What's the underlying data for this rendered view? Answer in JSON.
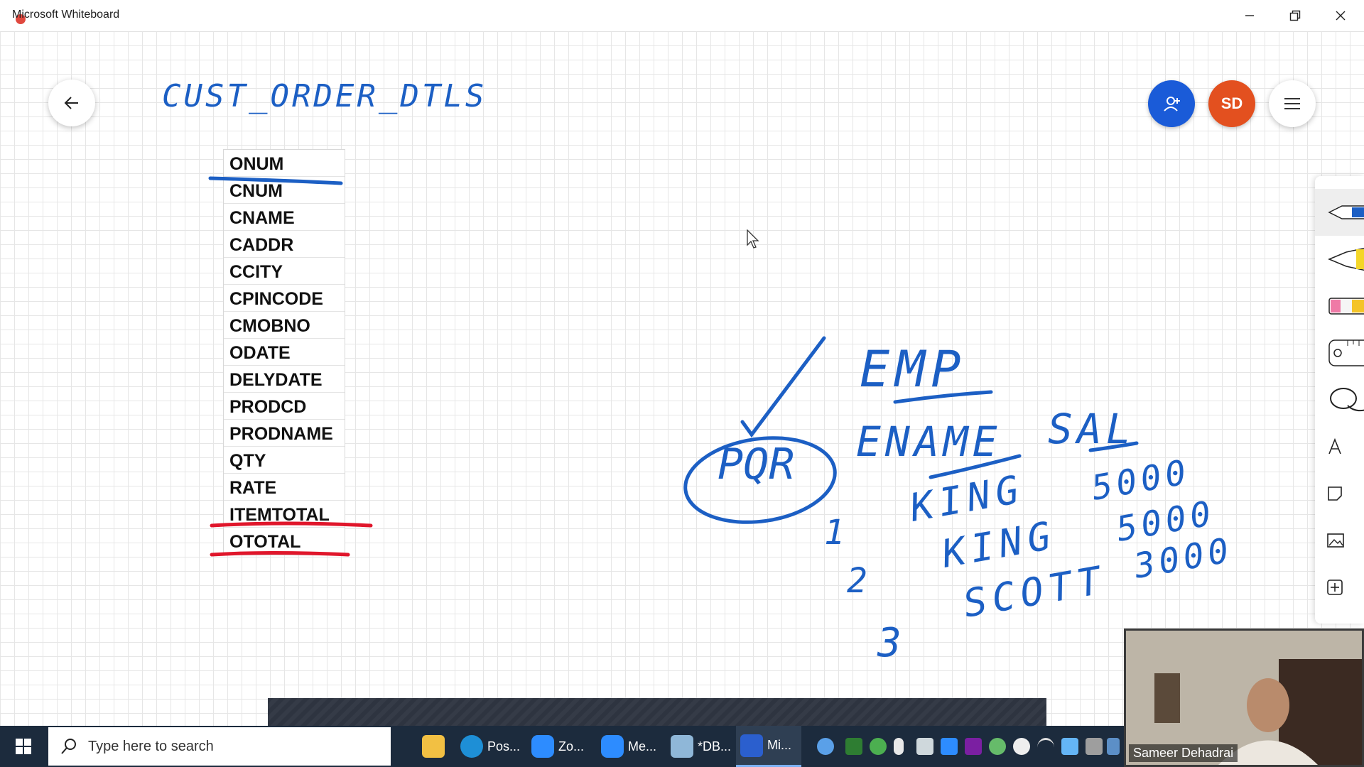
{
  "window": {
    "title": "Microsoft Whiteboard",
    "controls": [
      "minimize",
      "restore",
      "close"
    ]
  },
  "board": {
    "heading_handwritten": "CUST_ORDER_DTLS",
    "columns": [
      "ONUM",
      "CNUM",
      "CNAME",
      "CADDR",
      "CCITY",
      "CPINCODE",
      "CMOBNO",
      "ODATE",
      "DELYDATE",
      "PRODCD",
      "PRODNAME",
      "QTY",
      "RATE",
      "ITEMTOTAL",
      "OTOTAL"
    ],
    "struck_columns": [
      "ITEMTOTAL",
      "OTOTAL"
    ],
    "ink_colors": {
      "blue": "#1c5fc4",
      "red": "#e0162b"
    },
    "handwriting": {
      "table_name": "EMP",
      "circled": "PQR",
      "header_ename": "ENAME",
      "header_sal": "SAL",
      "row_numbers": [
        "1",
        "2",
        "3"
      ],
      "names": [
        "KING",
        "KING",
        "SCOTT"
      ],
      "salaries": [
        "5000",
        "5000",
        "3000"
      ]
    }
  },
  "top_right": {
    "avatar_initials": "SD",
    "invite_icon": "add-person-icon",
    "menu_icon": "hamburger-icon",
    "accent": "#1a5bd8",
    "avatar_color": "#e3501f"
  },
  "tools": [
    "pen-icon",
    "highlighter-icon",
    "eraser-icon",
    "ruler-icon",
    "lasso-icon",
    "text-icon",
    "note-icon",
    "image-icon",
    "add-icon"
  ],
  "video": {
    "participant_name": "Sameer Dehadrai"
  },
  "taskbar": {
    "search_placeholder": "Type here to search",
    "apps": [
      {
        "label": "",
        "icon": "file-explorer-icon",
        "color": "#f2c043"
      },
      {
        "label": "Pos...",
        "icon": "edge-icon",
        "color": "#1e8fd6"
      },
      {
        "label": "Zo...",
        "icon": "zoom-icon",
        "color": "#2d8cff"
      },
      {
        "label": "Me...",
        "icon": "zoom-meeting-icon",
        "color": "#2d8cff"
      },
      {
        "label": "*DB...",
        "icon": "notepad-icon",
        "color": "#8fb7d8"
      },
      {
        "label": "Mi...",
        "icon": "whiteboard-icon",
        "color": "#2b5fce"
      }
    ]
  }
}
